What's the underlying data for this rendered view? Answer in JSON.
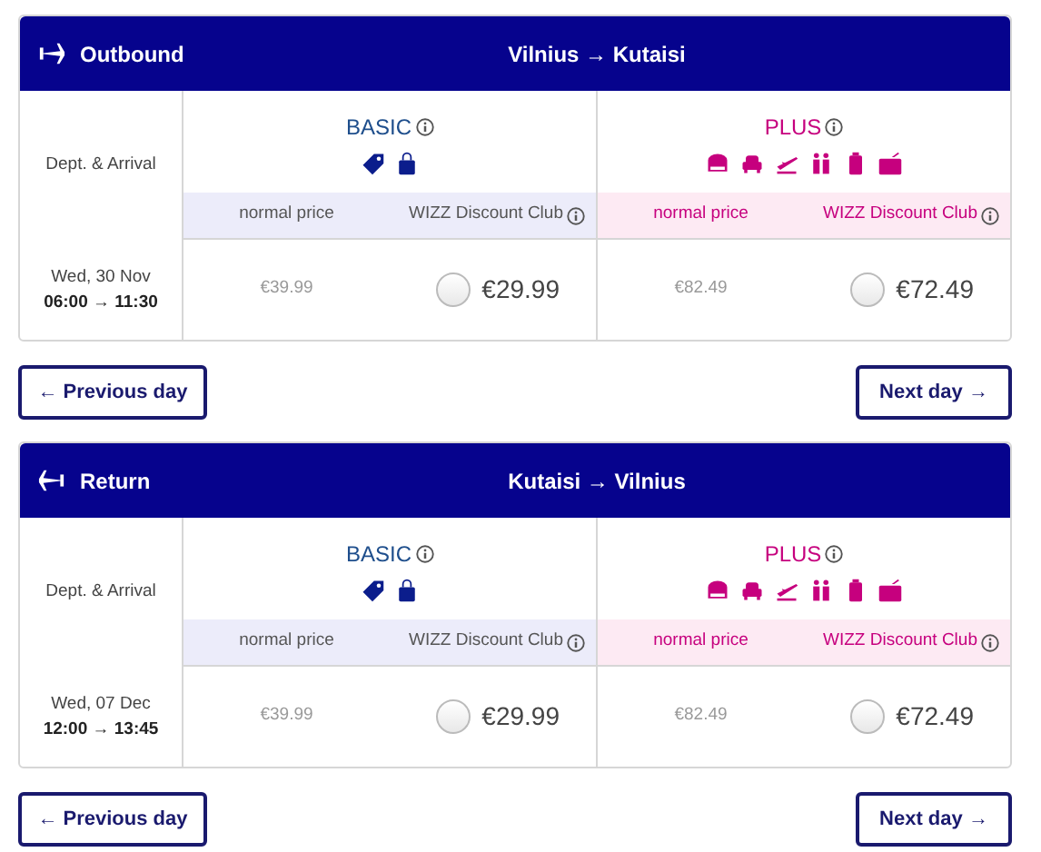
{
  "segments": [
    {
      "kind": "outbound",
      "title": "Outbound",
      "route": "Vilnius → Kutaisi",
      "dept_label": "Dept. & Arrival",
      "date": "Wed, 30 Nov",
      "times": "06:00 → 11:30",
      "fares": [
        {
          "kind": "basic",
          "name": "BASIC",
          "normal_label": "normal price",
          "club_label": "WIZZ Discount Club",
          "normal_price": "€39.99",
          "club_price": "€29.99",
          "selected": false
        },
        {
          "kind": "plus",
          "name": "PLUS",
          "normal_label": "normal price",
          "club_label": "WIZZ Discount Club",
          "normal_price": "€82.49",
          "club_price": "€72.49",
          "selected": false
        }
      ],
      "prev": "← Previous day",
      "next": "Next day →"
    },
    {
      "kind": "return",
      "title": "Return",
      "route": "Kutaisi → Vilnius",
      "dept_label": "Dept. & Arrival",
      "date": "Wed, 07 Dec",
      "times": "12:00 → 13:45",
      "fares": [
        {
          "kind": "basic",
          "name": "BASIC",
          "normal_label": "normal price",
          "club_label": "WIZZ Discount Club",
          "normal_price": "€39.99",
          "club_price": "€29.99",
          "selected": false
        },
        {
          "kind": "plus",
          "name": "PLUS",
          "normal_label": "normal price",
          "club_label": "WIZZ Discount Club",
          "normal_price": "€82.49",
          "club_price": "€72.49",
          "selected": false
        }
      ],
      "prev": "← Previous day",
      "next": "Next day →"
    }
  ]
}
